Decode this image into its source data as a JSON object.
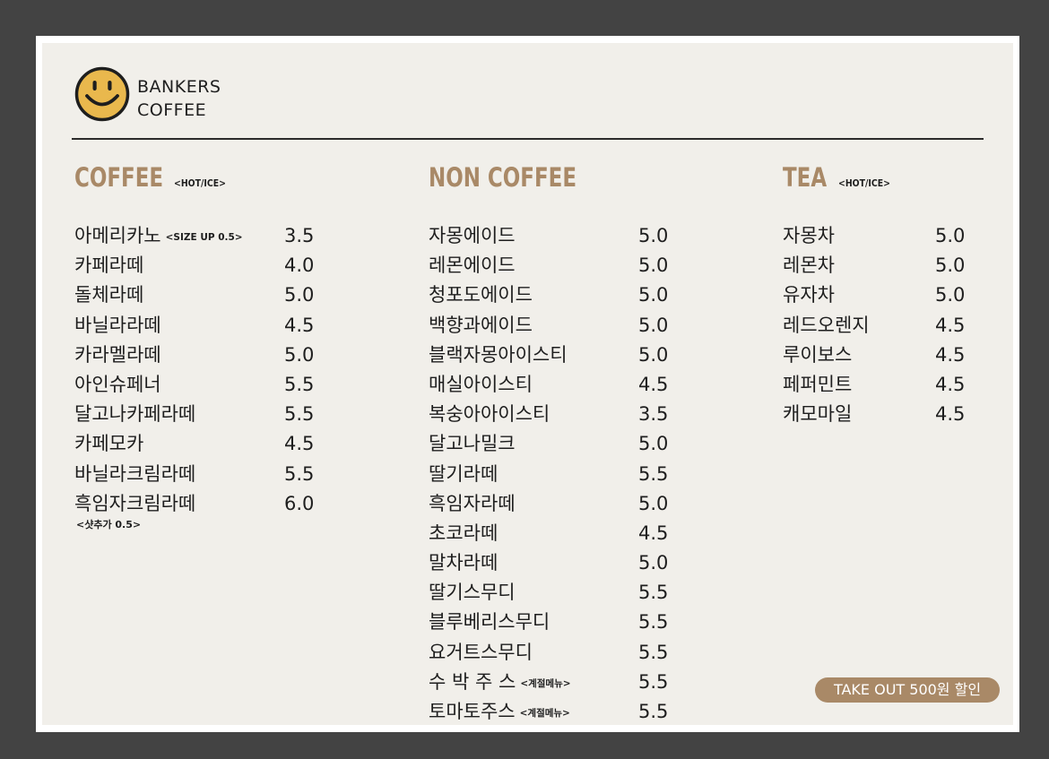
{
  "brand": {
    "line1": "BANKERS",
    "line2": "COFFEE",
    "logo_icon": "smiley-face-icon",
    "logo_color": "#e9b84d"
  },
  "colors": {
    "accent": "#a98967",
    "background": "#434343",
    "board": "#f1efea"
  },
  "coffee": {
    "title": "COFFEE",
    "subtitle": "<HOT/ICE>",
    "items": [
      {
        "name": "아메리카노",
        "note": "<SIZE UP  0.5>",
        "price": "3.5"
      },
      {
        "name": "카페라떼",
        "note": "",
        "price": "4.0"
      },
      {
        "name": "돌체라떼",
        "note": "",
        "price": "5.0"
      },
      {
        "name": "바닐라라떼",
        "note": "",
        "price": "4.5"
      },
      {
        "name": "카라멜라떼",
        "note": "",
        "price": "5.0"
      },
      {
        "name": "아인슈페너",
        "note": "",
        "price": "5.5"
      },
      {
        "name": "달고나카페라떼",
        "note": "",
        "price": "5.5"
      },
      {
        "name": "카페모카",
        "note": "",
        "price": "4.5"
      },
      {
        "name": "바닐라크림라떼",
        "note": "",
        "price": "5.5"
      },
      {
        "name": "흑임자크림라떼",
        "note": "",
        "price": "6.0"
      }
    ],
    "footnote": "<샷추가  0.5>"
  },
  "non_coffee": {
    "title": "NON COFFEE",
    "subtitle": "",
    "items": [
      {
        "name": "자몽에이드",
        "note": "",
        "price": "5.0"
      },
      {
        "name": "레몬에이드",
        "note": "",
        "price": "5.0"
      },
      {
        "name": "청포도에이드",
        "note": "",
        "price": "5.0"
      },
      {
        "name": "백향과에이드",
        "note": "",
        "price": "5.0"
      },
      {
        "name": "블랙자몽아이스티",
        "note": "",
        "price": "5.0"
      },
      {
        "name": "매실아이스티",
        "note": "",
        "price": "4.5"
      },
      {
        "name": "복숭아아이스티",
        "note": "",
        "price": "3.5"
      },
      {
        "name": "달고나밀크",
        "note": "",
        "price": "5.0"
      },
      {
        "name": "딸기라떼",
        "note": "",
        "price": "5.5"
      },
      {
        "name": "흑임자라떼",
        "note": "",
        "price": "5.0"
      },
      {
        "name": "초코라떼",
        "note": "",
        "price": "4.5"
      },
      {
        "name": "말차라떼",
        "note": "",
        "price": "5.0"
      },
      {
        "name": "딸기스무디",
        "note": "",
        "price": "5.5"
      },
      {
        "name": "블루베리스무디",
        "note": "",
        "price": "5.5"
      },
      {
        "name": "요거트스무디",
        "note": "",
        "price": "5.5"
      },
      {
        "name": "수 박 주 스",
        "note": "<계절메뉴>",
        "price": "5.5"
      },
      {
        "name": "토마토주스",
        "note": "<계절메뉴>",
        "price": "5.5"
      }
    ]
  },
  "tea": {
    "title": "TEA",
    "subtitle": "<HOT/ICE>",
    "items": [
      {
        "name": "자몽차",
        "note": "",
        "price": "5.0"
      },
      {
        "name": "레몬차",
        "note": "",
        "price": "5.0"
      },
      {
        "name": "유자차",
        "note": "",
        "price": "5.0"
      },
      {
        "name": "레드오렌지",
        "note": "",
        "price": "4.5"
      },
      {
        "name": "루이보스",
        "note": "",
        "price": "4.5"
      },
      {
        "name": "페퍼민트",
        "note": "",
        "price": "4.5"
      },
      {
        "name": "캐모마일",
        "note": "",
        "price": "4.5"
      }
    ]
  },
  "takeout_badge": "TAKE OUT 500원 할인"
}
